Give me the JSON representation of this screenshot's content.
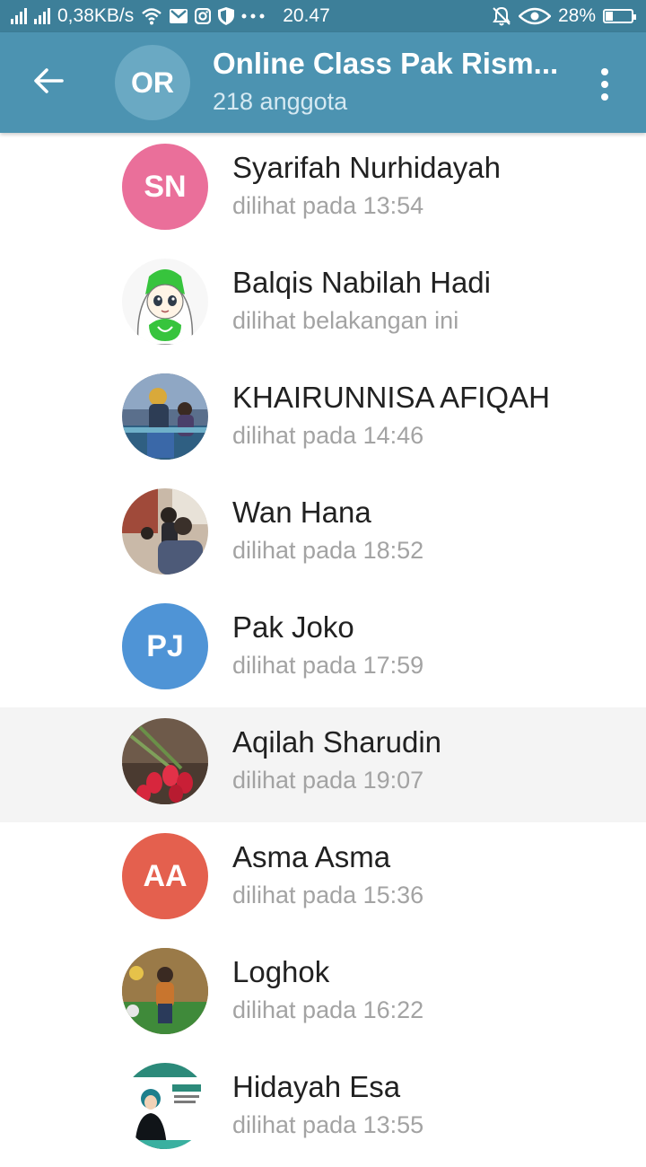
{
  "status_bar": {
    "network_speed": "0,38KB/s",
    "time": "20.47",
    "battery_percent": "28%",
    "battery_level": 0.28,
    "icons": [
      "signal-icon",
      "signal-icon",
      "wifi-icon",
      "mail-icon",
      "instagram-icon",
      "shield-icon",
      "more-dots-icon",
      "mute-bell-icon",
      "eye-icon",
      "battery-icon"
    ]
  },
  "header": {
    "back_icon": "arrow-left-icon",
    "avatar_initials": "OR",
    "title": "Online Class Pak Rism...",
    "subtitle": "218 anggota",
    "menu_icon": "vertical-dots-icon"
  },
  "colors": {
    "statusbar": "#3d7f99",
    "appbar": "#4c93b1",
    "avatar_sn": "#ea6f9a",
    "avatar_pj": "#4f94d6",
    "avatar_aa": "#e4604e"
  },
  "members": [
    {
      "name": "Syarifah Nurhidayah",
      "status": "dilihat pada 13:54",
      "initials": "SN"
    },
    {
      "name": "Balqis Nabilah Hadi",
      "status": "dilihat belakangan ini",
      "initials": ""
    },
    {
      "name": "KHAIRUNNISA AFIQAH",
      "status": "dilihat pada 14:46",
      "initials": ""
    },
    {
      "name": "Wan Hana",
      "status": "dilihat pada 18:52",
      "initials": ""
    },
    {
      "name": "Pak Joko",
      "status": "dilihat pada 17:59",
      "initials": "PJ"
    },
    {
      "name": "Aqilah Sharudin",
      "status": "dilihat pada 19:07",
      "initials": ""
    },
    {
      "name": "Asma Asma",
      "status": "dilihat pada 15:36",
      "initials": "AA"
    },
    {
      "name": "Loghok",
      "status": "dilihat pada 16:22",
      "initials": ""
    },
    {
      "name": "Hidayah Esa",
      "status": "dilihat pada 13:55",
      "initials": ""
    }
  ]
}
